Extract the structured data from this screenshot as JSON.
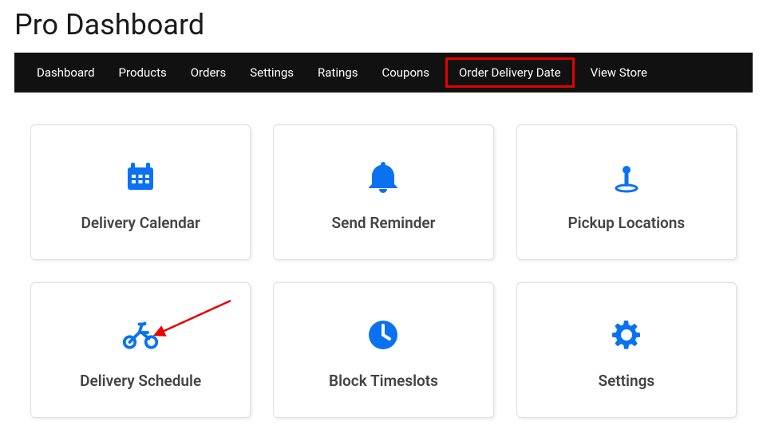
{
  "page_title": "Pro Dashboard",
  "nav": {
    "items": [
      {
        "label": "Dashboard",
        "active": false
      },
      {
        "label": "Products",
        "active": false
      },
      {
        "label": "Orders",
        "active": false
      },
      {
        "label": "Settings",
        "active": false
      },
      {
        "label": "Ratings",
        "active": false
      },
      {
        "label": "Coupons",
        "active": false
      },
      {
        "label": "Order Delivery Date",
        "active": true
      },
      {
        "label": "View Store",
        "active": false
      }
    ]
  },
  "cards": [
    {
      "label": "Delivery Calendar",
      "icon": "calendar-icon"
    },
    {
      "label": "Send Reminder",
      "icon": "bell-icon"
    },
    {
      "label": "Pickup Locations",
      "icon": "map-pin-icon"
    },
    {
      "label": "Delivery Schedule",
      "icon": "bicycle-icon",
      "annotated": true
    },
    {
      "label": "Block Timeslots",
      "icon": "clock-icon"
    },
    {
      "label": "Settings",
      "icon": "gear-icon"
    }
  ],
  "annotation": {
    "target_card": "Delivery Schedule",
    "style": "red-arrow"
  },
  "accent_color": "#0a72f0"
}
